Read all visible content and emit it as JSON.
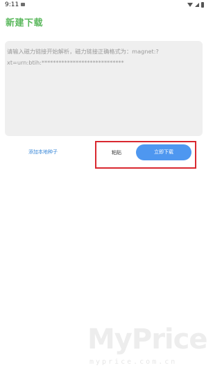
{
  "status_bar": {
    "time": "9:11"
  },
  "header": {
    "title": "新建下载"
  },
  "magnet_input": {
    "value": "",
    "placeholder": "请输入磁力链接开始解析，磁力链接正确格式为：magnet:?xt=urn:btih:*****************************"
  },
  "actions": {
    "add_local_torrent_label": "添加本地种子",
    "paste_label": "粘贴",
    "download_now_label": "立即下载"
  },
  "watermark": {
    "logo_text": "MyPrice",
    "url_text": "myprice.com.cn"
  },
  "colors": {
    "title": "#5bb85d",
    "link": "#3a88d8",
    "primary_button": "#4e97f0",
    "highlight": "#d9282f",
    "input_background": "#efefef"
  }
}
